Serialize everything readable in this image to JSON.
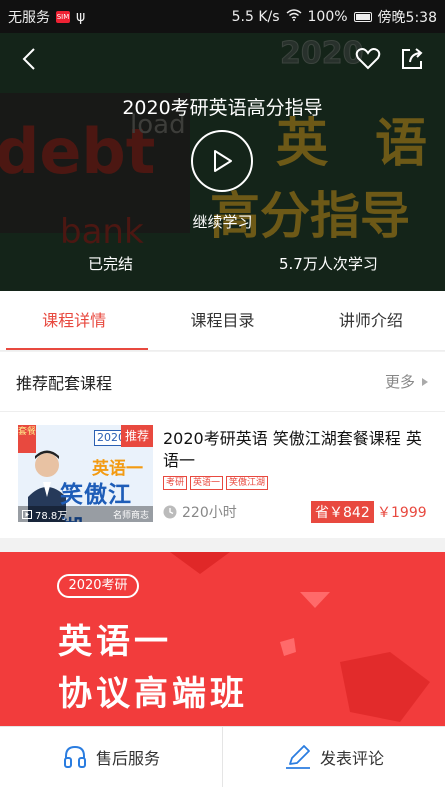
{
  "status_bar": {
    "carrier": "无服务",
    "network_speed": "5.5 K/s",
    "battery": "100%",
    "time": "傍晚5:38"
  },
  "hero": {
    "title": "2020考研英语高分指导",
    "continue_label": "继续学习",
    "progress_label": "已完结",
    "learners_label": "5.7万人次学习",
    "bg_year": "2020",
    "bg_words": [
      "英",
      "语",
      "高分指导"
    ],
    "bg_english": [
      "debt",
      "bank",
      "load"
    ]
  },
  "tabs": [
    {
      "label": "课程详情",
      "active": true
    },
    {
      "label": "课程目录",
      "active": false
    },
    {
      "label": "讲师介绍",
      "active": false
    }
  ],
  "recommend": {
    "title": "推荐配套课程",
    "more_label": "更多"
  },
  "course": {
    "title": "2020考研英语 笑傲江湖套餐课程 英语一",
    "tags": [
      "考研",
      "英语一",
      "笑傲江湖"
    ],
    "hours": "220小时",
    "save_label": "省￥842",
    "price": "￥1999",
    "thumb": {
      "corner_tag": "套餐",
      "badge": "推荐",
      "year": "2020",
      "subject": "英语一",
      "name": "笑傲江湖",
      "views": "78.8万",
      "teacher": "名师商志"
    }
  },
  "banner": {
    "pill": "2020考研",
    "line1": "英语一",
    "line2": "协议高端班"
  },
  "bottom_bar": {
    "service_label": "售后服务",
    "comment_label": "发表评论"
  },
  "colors": {
    "accent": "#e8493f",
    "banner": "#f23c3c",
    "link_blue": "#2b7de0"
  }
}
